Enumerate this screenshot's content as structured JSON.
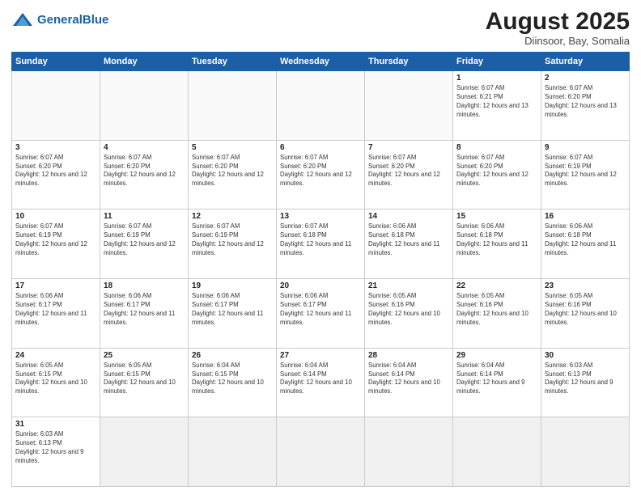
{
  "header": {
    "logo_general": "General",
    "logo_blue": "Blue",
    "title": "August 2025",
    "subtitle": "Diinsoor, Bay, Somalia"
  },
  "days_of_week": [
    "Sunday",
    "Monday",
    "Tuesday",
    "Wednesday",
    "Thursday",
    "Friday",
    "Saturday"
  ],
  "weeks": [
    [
      {
        "day": "",
        "info": ""
      },
      {
        "day": "",
        "info": ""
      },
      {
        "day": "",
        "info": ""
      },
      {
        "day": "",
        "info": ""
      },
      {
        "day": "",
        "info": ""
      },
      {
        "day": "1",
        "info": "Sunrise: 6:07 AM\nSunset: 6:21 PM\nDaylight: 12 hours and 13 minutes."
      },
      {
        "day": "2",
        "info": "Sunrise: 6:07 AM\nSunset: 6:20 PM\nDaylight: 12 hours and 13 minutes."
      }
    ],
    [
      {
        "day": "3",
        "info": "Sunrise: 6:07 AM\nSunset: 6:20 PM\nDaylight: 12 hours and 12 minutes."
      },
      {
        "day": "4",
        "info": "Sunrise: 6:07 AM\nSunset: 6:20 PM\nDaylight: 12 hours and 12 minutes."
      },
      {
        "day": "5",
        "info": "Sunrise: 6:07 AM\nSunset: 6:20 PM\nDaylight: 12 hours and 12 minutes."
      },
      {
        "day": "6",
        "info": "Sunrise: 6:07 AM\nSunset: 6:20 PM\nDaylight: 12 hours and 12 minutes."
      },
      {
        "day": "7",
        "info": "Sunrise: 6:07 AM\nSunset: 6:20 PM\nDaylight: 12 hours and 12 minutes."
      },
      {
        "day": "8",
        "info": "Sunrise: 6:07 AM\nSunset: 6:20 PM\nDaylight: 12 hours and 12 minutes."
      },
      {
        "day": "9",
        "info": "Sunrise: 6:07 AM\nSunset: 6:19 PM\nDaylight: 12 hours and 12 minutes."
      }
    ],
    [
      {
        "day": "10",
        "info": "Sunrise: 6:07 AM\nSunset: 6:19 PM\nDaylight: 12 hours and 12 minutes."
      },
      {
        "day": "11",
        "info": "Sunrise: 6:07 AM\nSunset: 6:19 PM\nDaylight: 12 hours and 12 minutes."
      },
      {
        "day": "12",
        "info": "Sunrise: 6:07 AM\nSunset: 6:19 PM\nDaylight: 12 hours and 12 minutes."
      },
      {
        "day": "13",
        "info": "Sunrise: 6:07 AM\nSunset: 6:18 PM\nDaylight: 12 hours and 11 minutes."
      },
      {
        "day": "14",
        "info": "Sunrise: 6:06 AM\nSunset: 6:18 PM\nDaylight: 12 hours and 11 minutes."
      },
      {
        "day": "15",
        "info": "Sunrise: 6:06 AM\nSunset: 6:18 PM\nDaylight: 12 hours and 11 minutes."
      },
      {
        "day": "16",
        "info": "Sunrise: 6:06 AM\nSunset: 6:18 PM\nDaylight: 12 hours and 11 minutes."
      }
    ],
    [
      {
        "day": "17",
        "info": "Sunrise: 6:06 AM\nSunset: 6:17 PM\nDaylight: 12 hours and 11 minutes."
      },
      {
        "day": "18",
        "info": "Sunrise: 6:06 AM\nSunset: 6:17 PM\nDaylight: 12 hours and 11 minutes."
      },
      {
        "day": "19",
        "info": "Sunrise: 6:06 AM\nSunset: 6:17 PM\nDaylight: 12 hours and 11 minutes."
      },
      {
        "day": "20",
        "info": "Sunrise: 6:06 AM\nSunset: 6:17 PM\nDaylight: 12 hours and 11 minutes."
      },
      {
        "day": "21",
        "info": "Sunrise: 6:05 AM\nSunset: 6:16 PM\nDaylight: 12 hours and 10 minutes."
      },
      {
        "day": "22",
        "info": "Sunrise: 6:05 AM\nSunset: 6:16 PM\nDaylight: 12 hours and 10 minutes."
      },
      {
        "day": "23",
        "info": "Sunrise: 6:05 AM\nSunset: 6:16 PM\nDaylight: 12 hours and 10 minutes."
      }
    ],
    [
      {
        "day": "24",
        "info": "Sunrise: 6:05 AM\nSunset: 6:15 PM\nDaylight: 12 hours and 10 minutes."
      },
      {
        "day": "25",
        "info": "Sunrise: 6:05 AM\nSunset: 6:15 PM\nDaylight: 12 hours and 10 minutes."
      },
      {
        "day": "26",
        "info": "Sunrise: 6:04 AM\nSunset: 6:15 PM\nDaylight: 12 hours and 10 minutes."
      },
      {
        "day": "27",
        "info": "Sunrise: 6:04 AM\nSunset: 6:14 PM\nDaylight: 12 hours and 10 minutes."
      },
      {
        "day": "28",
        "info": "Sunrise: 6:04 AM\nSunset: 6:14 PM\nDaylight: 12 hours and 10 minutes."
      },
      {
        "day": "29",
        "info": "Sunrise: 6:04 AM\nSunset: 6:14 PM\nDaylight: 12 hours and 9 minutes."
      },
      {
        "day": "30",
        "info": "Sunrise: 6:03 AM\nSunset: 6:13 PM\nDaylight: 12 hours and 9 minutes."
      }
    ],
    [
      {
        "day": "31",
        "info": "Sunrise: 6:03 AM\nSunset: 6:13 PM\nDaylight: 12 hours and 9 minutes."
      },
      {
        "day": "",
        "info": ""
      },
      {
        "day": "",
        "info": ""
      },
      {
        "day": "",
        "info": ""
      },
      {
        "day": "",
        "info": ""
      },
      {
        "day": "",
        "info": ""
      },
      {
        "day": "",
        "info": ""
      }
    ]
  ]
}
